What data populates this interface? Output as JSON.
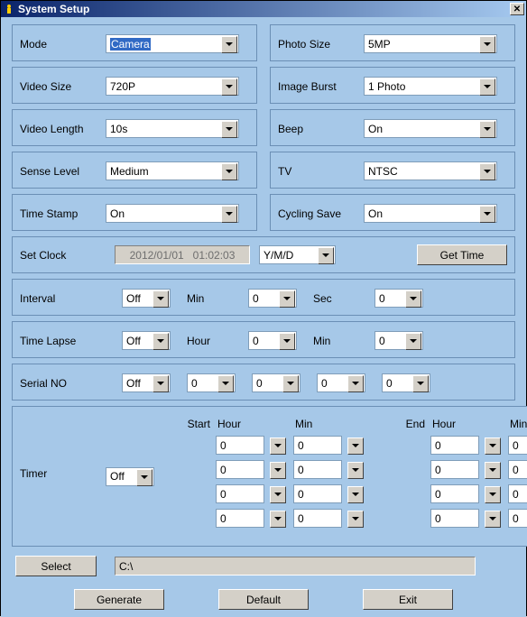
{
  "window": {
    "title": "System Setup"
  },
  "fields": {
    "mode": {
      "label": "Mode",
      "value": "Camera"
    },
    "photo_size": {
      "label": "Photo Size",
      "value": "5MP"
    },
    "video_size": {
      "label": "Video Size",
      "value": "720P"
    },
    "image_burst": {
      "label": "Image Burst",
      "value": "1 Photo"
    },
    "video_length": {
      "label": "Video Length",
      "value": "10s"
    },
    "beep": {
      "label": "Beep",
      "value": "On"
    },
    "sense_level": {
      "label": "Sense Level",
      "value": "Medium"
    },
    "tv": {
      "label": "TV",
      "value": "NTSC"
    },
    "time_stamp": {
      "label": "Time Stamp",
      "value": "On"
    },
    "cycling_save": {
      "label": "Cycling Save",
      "value": "On"
    }
  },
  "clock": {
    "label": "Set Clock",
    "value": "2012/01/01   01:02:03",
    "format": "Y/M/D",
    "button": "Get Time"
  },
  "interval": {
    "label": "Interval",
    "value": "Off",
    "min_label": "Min",
    "min": "0",
    "sec_label": "Sec",
    "sec": "0"
  },
  "timelapse": {
    "label": "Time Lapse",
    "value": "Off",
    "hour_label": "Hour",
    "hour": "0",
    "min_label": "Min",
    "min": "0"
  },
  "serial": {
    "label": "Serial NO",
    "enable": "Off",
    "d1": "0",
    "d2": "0",
    "d3": "0",
    "d4": "0"
  },
  "timer": {
    "label": "Timer",
    "enable": "Off",
    "start_label": "Start",
    "end_label": "End",
    "hour_label": "Hour",
    "min_label": "Min",
    "rows": [
      {
        "sh": "0",
        "sm": "0",
        "eh": "0",
        "em": "0"
      },
      {
        "sh": "0",
        "sm": "0",
        "eh": "0",
        "em": "0"
      },
      {
        "sh": "0",
        "sm": "0",
        "eh": "0",
        "em": "0"
      },
      {
        "sh": "0",
        "sm": "0",
        "eh": "0",
        "em": "0"
      }
    ]
  },
  "path": {
    "select_btn": "Select",
    "value": "C:\\"
  },
  "actions": {
    "generate": "Generate",
    "default": "Default",
    "exit": "Exit"
  }
}
